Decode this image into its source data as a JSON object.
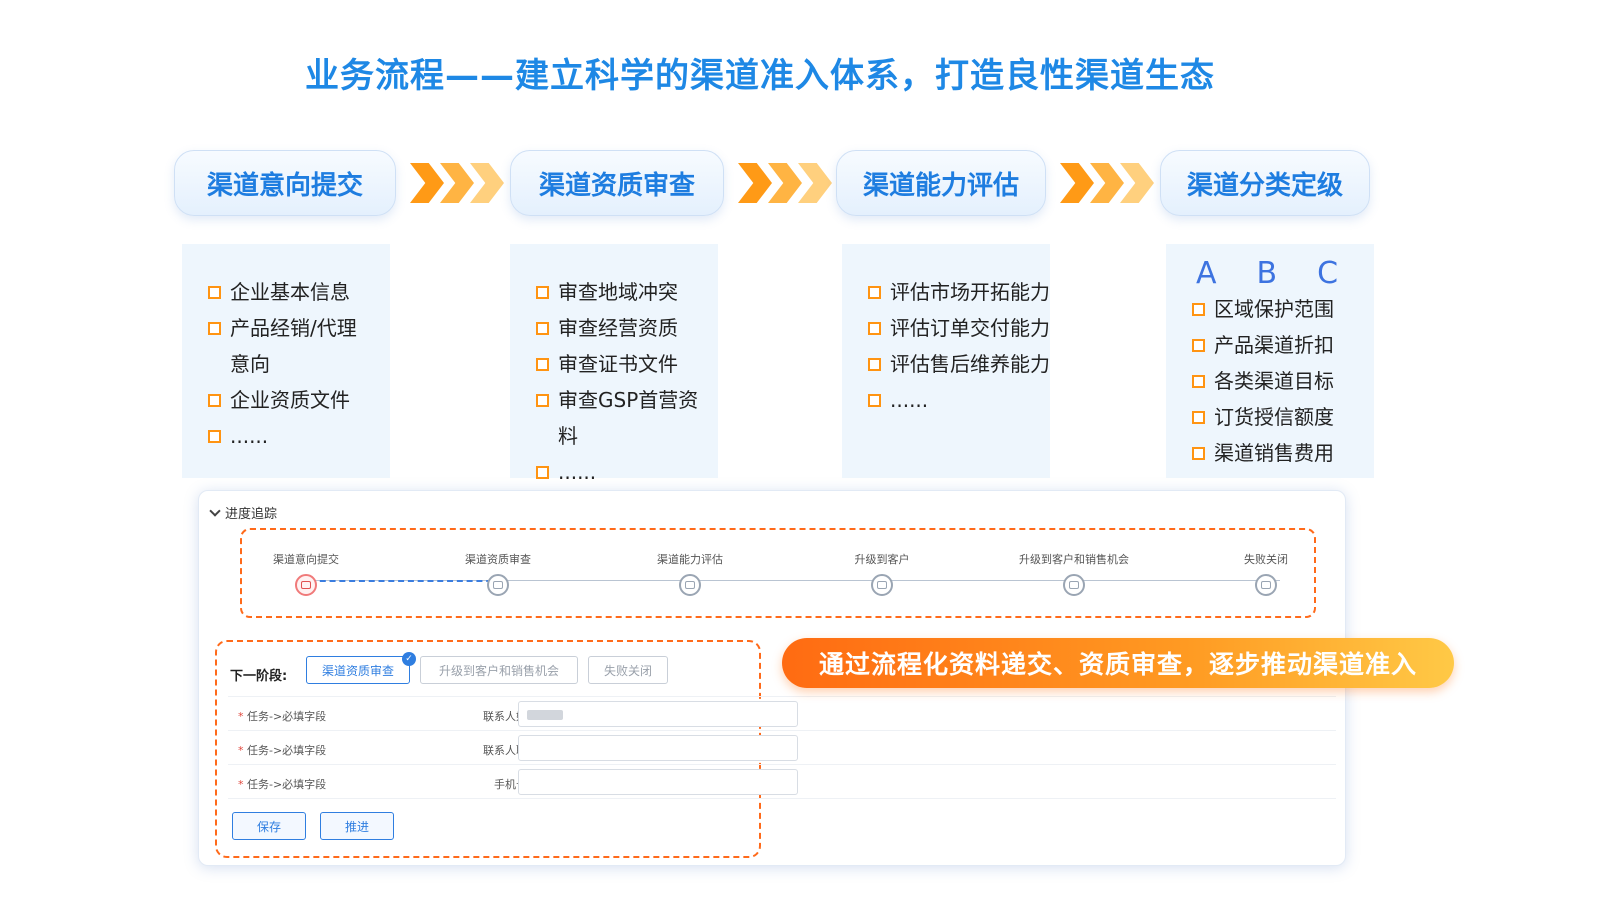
{
  "title": "业务流程——建立科学的渠道准入体系，打造良性渠道生态",
  "stages": [
    {
      "label": "渠道意向提交",
      "items": [
        "企业基本信息",
        "产品经销/代理",
        "意向",
        "企业资质文件",
        "......"
      ]
    },
    {
      "label": "渠道资质审查",
      "items": [
        "审查地域冲突",
        "审查经营资质",
        "审查证书文件",
        "审查GSP首营资料",
        "......"
      ]
    },
    {
      "label": "渠道能力评估",
      "items": [
        "评估市场开拓能力",
        "评估订单交付能力",
        "评估售后维养能力",
        "......"
      ]
    },
    {
      "label": "渠道分类定级",
      "grades": [
        "A",
        "B",
        "C"
      ],
      "items": [
        "区域保护范围",
        "产品渠道折扣",
        "各类渠道目标",
        "订货授信额度",
        "渠道销售费用"
      ]
    }
  ],
  "panel": {
    "section_title": "进度追踪",
    "progress_steps": [
      "渠道意向提交",
      "渠道资质审查",
      "渠道能力评估",
      "升级到客户",
      "升级到客户和销售机会",
      "失败关闭"
    ],
    "current_step": 0,
    "next_stage_label": "下一阶段:",
    "next_options": [
      "渠道资质审查",
      "升级到客户和销售机会",
      "失败关闭"
    ],
    "selected_option": 0,
    "form_rows": [
      {
        "required": "*",
        "task": "任务->必填字段",
        "field": "联系人姓名"
      },
      {
        "required": "*",
        "task": "任务->必填字段",
        "field": "联系人职务"
      },
      {
        "required": "*",
        "task": "任务->必填字段",
        "field": "手机号码"
      }
    ],
    "save_label": "保存",
    "advance_label": "推进"
  },
  "banner": "通过流程化资料递交、资质审查，逐步推动渠道准入",
  "colors": {
    "title": "#1e88e5",
    "accent_orange": "#ff6a1a",
    "primary": "#2f7ee0"
  }
}
